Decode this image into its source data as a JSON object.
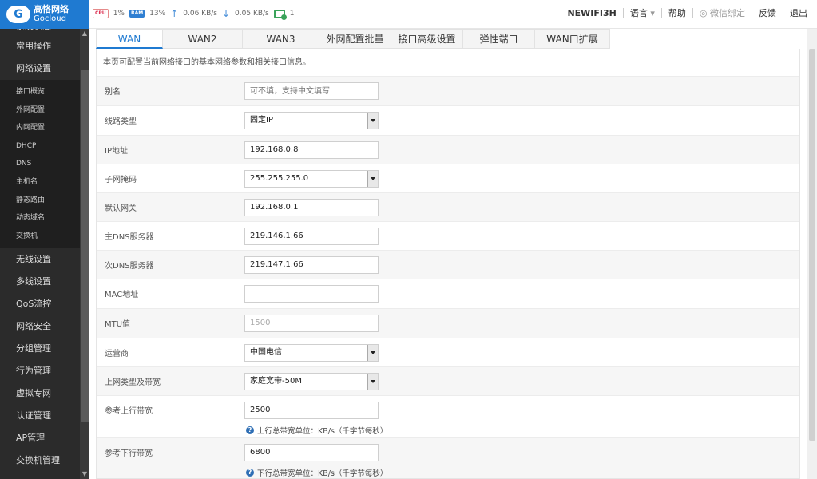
{
  "brand": {
    "name_cn": "高恪网络",
    "name_en": "Gocloud"
  },
  "status": {
    "cpu_badge": "CPU",
    "cpu_percent": "1%",
    "ram_badge": "RAM",
    "ram_percent": "13%",
    "upload": "0.06 KB/s",
    "download": "0.05 KB/s",
    "online_count": "1"
  },
  "topnav": {
    "device": "NEWIFI3H",
    "language": "语言",
    "help": "帮助",
    "wechat": "微信绑定",
    "feedback": "反馈",
    "logout": "退出"
  },
  "sidebar": {
    "top_partial": "系统状态",
    "items_before": [
      "常用操作",
      "网络设置"
    ],
    "sub_items": [
      "接口概览",
      "外网配置",
      "内网配置",
      "DHCP",
      "DNS",
      "主机名",
      "静态路由",
      "动态域名",
      "交换机"
    ],
    "items_after": [
      "无线设置",
      "多线设置",
      "QoS流控",
      "网络安全",
      "分组管理",
      "行为管理",
      "虚拟专网",
      "认证管理",
      "AP管理",
      "交换机管理"
    ]
  },
  "tabs": [
    "WAN",
    "WAN2",
    "WAN3",
    "外网配置批量",
    "接口高级设置",
    "弹性端口",
    "WAN口扩展"
  ],
  "notice": "本页可配置当前网络接口的基本网络参数和相关接口信息。",
  "form": {
    "alias": {
      "label": "别名",
      "placeholder": "可不填，支持中文填写"
    },
    "line_type": {
      "label": "线路类型",
      "value": "固定IP"
    },
    "ip": {
      "label": "IP地址",
      "value": "192.168.0.8"
    },
    "netmask": {
      "label": "子网掩码",
      "value": "255.255.255.0"
    },
    "gateway": {
      "label": "默认网关",
      "value": "192.168.0.1"
    },
    "dns1": {
      "label": "主DNS服务器",
      "value": "219.146.1.66"
    },
    "dns2": {
      "label": "次DNS服务器",
      "value": "219.147.1.66"
    },
    "mac": {
      "label": "MAC地址",
      "value": ""
    },
    "mtu": {
      "label": "MTU值",
      "value": "1500"
    },
    "isp": {
      "label": "运营商",
      "value": "中国电信"
    },
    "access": {
      "label": "上网类型及带宽",
      "value": "家庭宽带-50M"
    },
    "up_bw": {
      "label": "参考上行带宽",
      "value": "2500",
      "hint": "上行总带宽单位：KB/s（千字节每秒）"
    },
    "down_bw": {
      "label": "参考下行带宽",
      "value": "6800",
      "hint": "下行总带宽单位：KB/s（千字节每秒）"
    }
  },
  "colors": {
    "accent": "#1f7ad1",
    "sidebar_bg": "#2b2b2b",
    "sidebar_sub_bg": "#1f1f1f"
  }
}
